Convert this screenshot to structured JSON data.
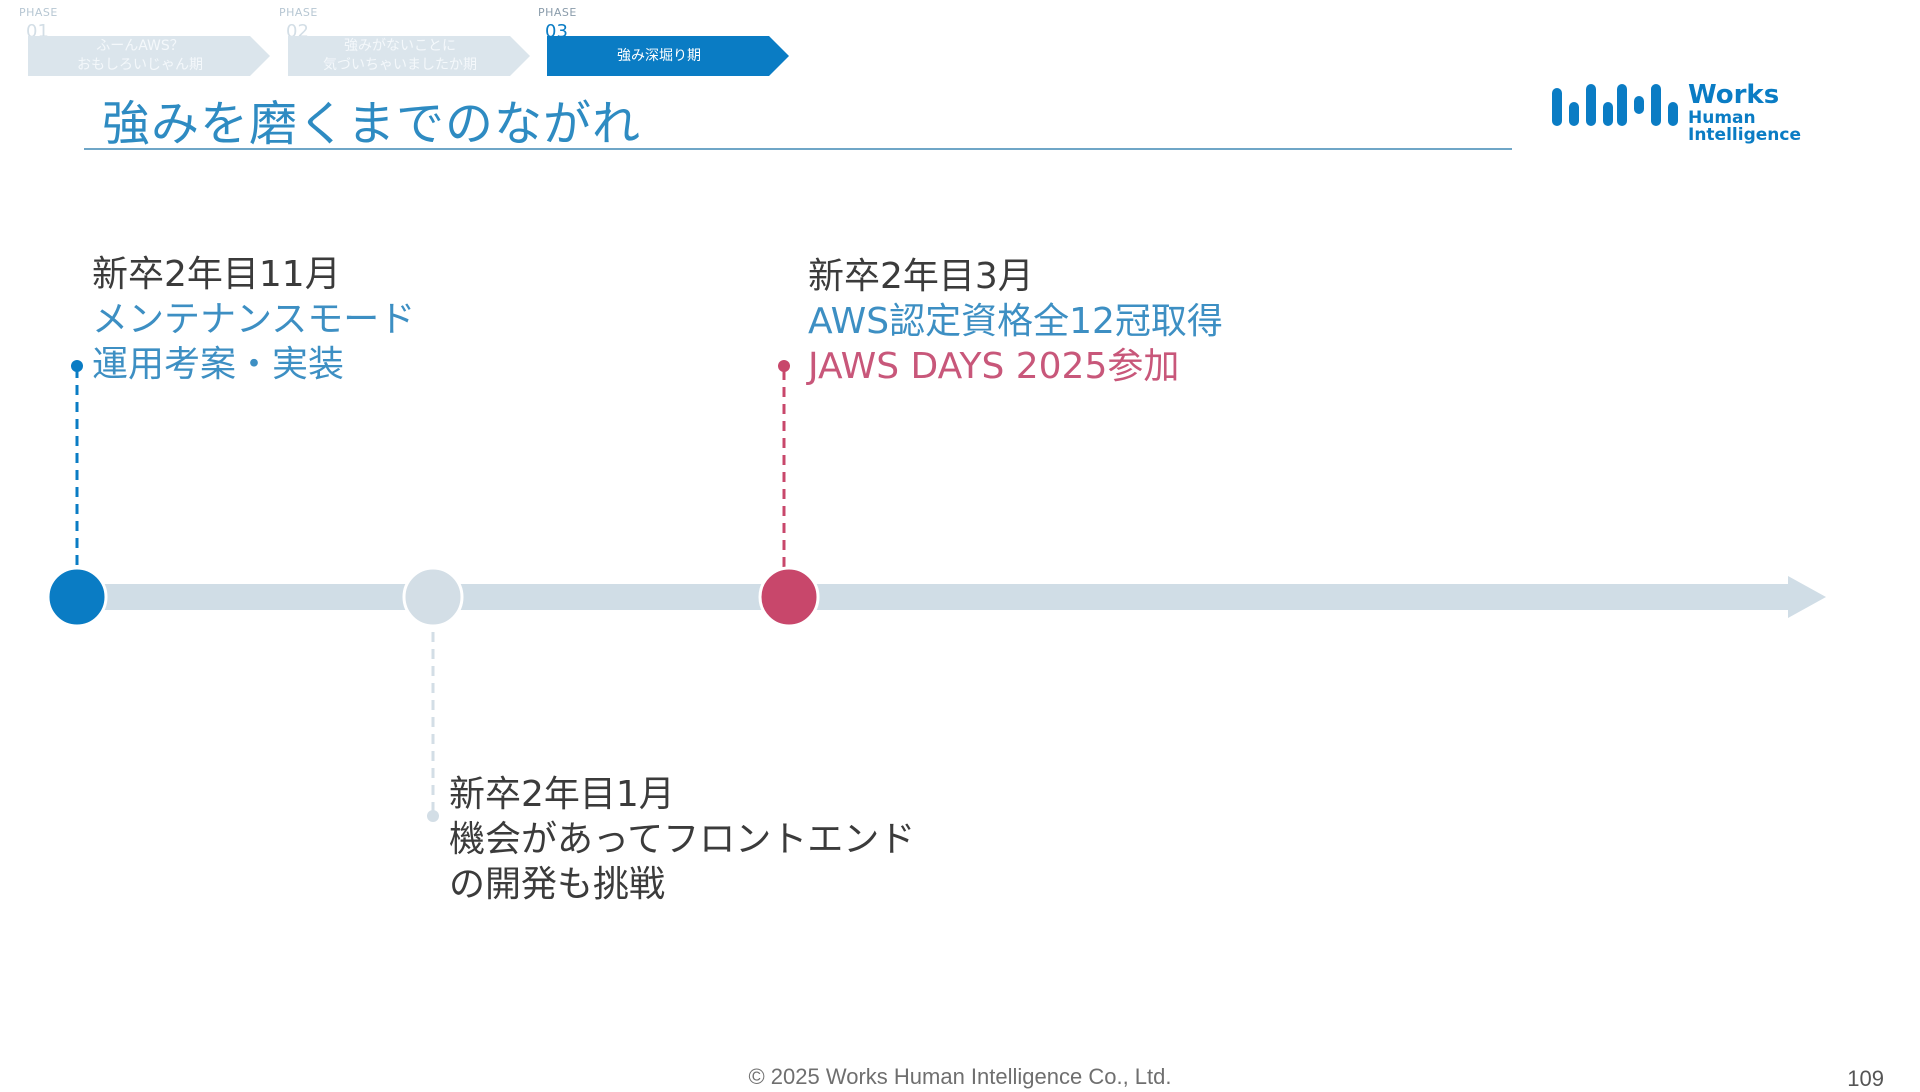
{
  "phases": [
    {
      "tag": "PHASE",
      "number": "01",
      "label": "ふーんAWS？\nおもしろいじゃん期",
      "active": false
    },
    {
      "tag": "PHASE",
      "number": "02",
      "label": "強みがないことに\n気づいちゃいましたか期",
      "active": false
    },
    {
      "tag": "PHASE",
      "number": "03",
      "label": "強み深堀り期",
      "active": true
    }
  ],
  "title": "強みを磨くまでのながれ",
  "logo": {
    "line1": "Works",
    "line2": "Human Intelligence",
    "color": "#0a7cc4"
  },
  "timeline": {
    "events": [
      {
        "date": "新卒2年目11月",
        "lines": [
          "メンテナンスモード",
          "運用考案・実装"
        ],
        "color": "#0a7cc4"
      },
      {
        "date": "新卒2年目1月",
        "lines": [
          "機会があってフロントエンド",
          "の開発も挑戦"
        ],
        "color": "#d3dee6"
      },
      {
        "date": "新卒2年目3月",
        "lines": [
          "AWS認定資格全12冠取得",
          "JAWS DAYS 2025参加"
        ],
        "color": "#c8476b"
      }
    ]
  },
  "footer": {
    "copyright": "© 2025 Works Human Intelligence Co., Ltd.",
    "page": "109"
  }
}
